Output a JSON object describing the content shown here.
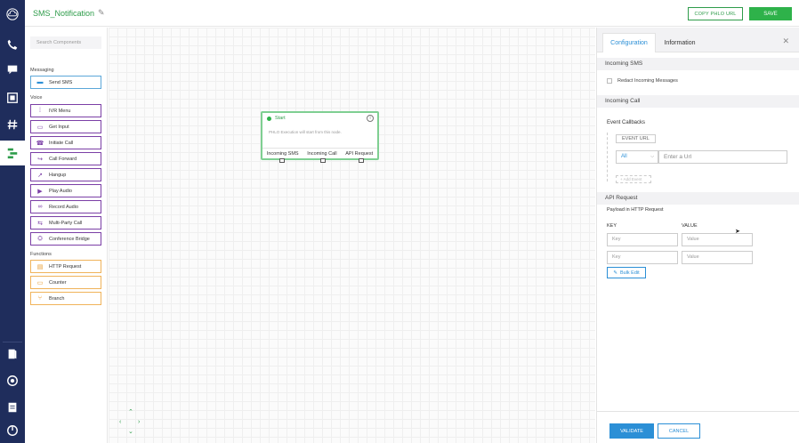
{
  "app": {
    "title": "SMS_Notification",
    "copy_url_label": "COPY PHLO URL",
    "save_label": "SAVE"
  },
  "nav_rail": {
    "icons": [
      "cloud-icon",
      "phone-icon",
      "messages-icon",
      "media-icon",
      "hash-icon",
      "phlo-icon",
      "book-icon",
      "support-icon",
      "billing-icon",
      "logout-icon"
    ],
    "active": "phlo-icon"
  },
  "components": {
    "search_placeholder": "Search Components",
    "sections": [
      {
        "label": "Messaging",
        "items": [
          {
            "label": "Send SMS",
            "icon": "chat-icon"
          }
        ]
      },
      {
        "label": "Voice",
        "items": [
          {
            "label": "IVR Menu",
            "icon": "keypad-icon"
          },
          {
            "label": "Get Input",
            "icon": "input-icon"
          },
          {
            "label": "Initiate Call",
            "icon": "phone-icon"
          },
          {
            "label": "Call Forward",
            "icon": "forward-icon"
          },
          {
            "label": "Hangup",
            "icon": "hangup-icon"
          },
          {
            "label": "Play Audio",
            "icon": "play-icon"
          },
          {
            "label": "Record Audio",
            "icon": "record-icon"
          },
          {
            "label": "Multi-Party Call",
            "icon": "multiparty-icon"
          },
          {
            "label": "Conference Bridge",
            "icon": "conference-icon"
          }
        ]
      },
      {
        "label": "Functions",
        "items": [
          {
            "label": "HTTP Request",
            "icon": "http-icon"
          },
          {
            "label": "Counter",
            "icon": "counter-icon"
          },
          {
            "label": "Branch",
            "icon": "branch-icon"
          }
        ]
      }
    ]
  },
  "canvas": {
    "start_node": {
      "title": "Start",
      "description": "PHLO Execution will start from this node.",
      "ports": [
        "Incoming SMS",
        "Incoming Call",
        "API Request"
      ]
    }
  },
  "panel": {
    "tabs": [
      "Configuration",
      "Information"
    ],
    "active_tab": "Configuration",
    "incoming_sms": {
      "header": "Incoming SMS",
      "checkbox_label": "Redact Incoming Messages",
      "checked": false
    },
    "incoming_call": {
      "header": "Incoming Call",
      "event_callbacks_label": "Event Callbacks",
      "event_url_legend": "EVENT URL",
      "method_value": "All",
      "url_placeholder": "Enter a Url",
      "add_event_label": "+ Add Event"
    },
    "api_request": {
      "header": "API Request",
      "payload_label": "Payload in HTTP Request",
      "key_header": "KEY",
      "value_header": "VALUE",
      "rows": [
        {
          "key_placeholder": "Key",
          "value_placeholder": "Value"
        },
        {
          "key_placeholder": "Key",
          "value_placeholder": "Value"
        }
      ],
      "bulk_edit_label": "Bulk Edit"
    },
    "footer": {
      "validate_label": "VALIDATE",
      "cancel_label": "CANCEL"
    }
  }
}
